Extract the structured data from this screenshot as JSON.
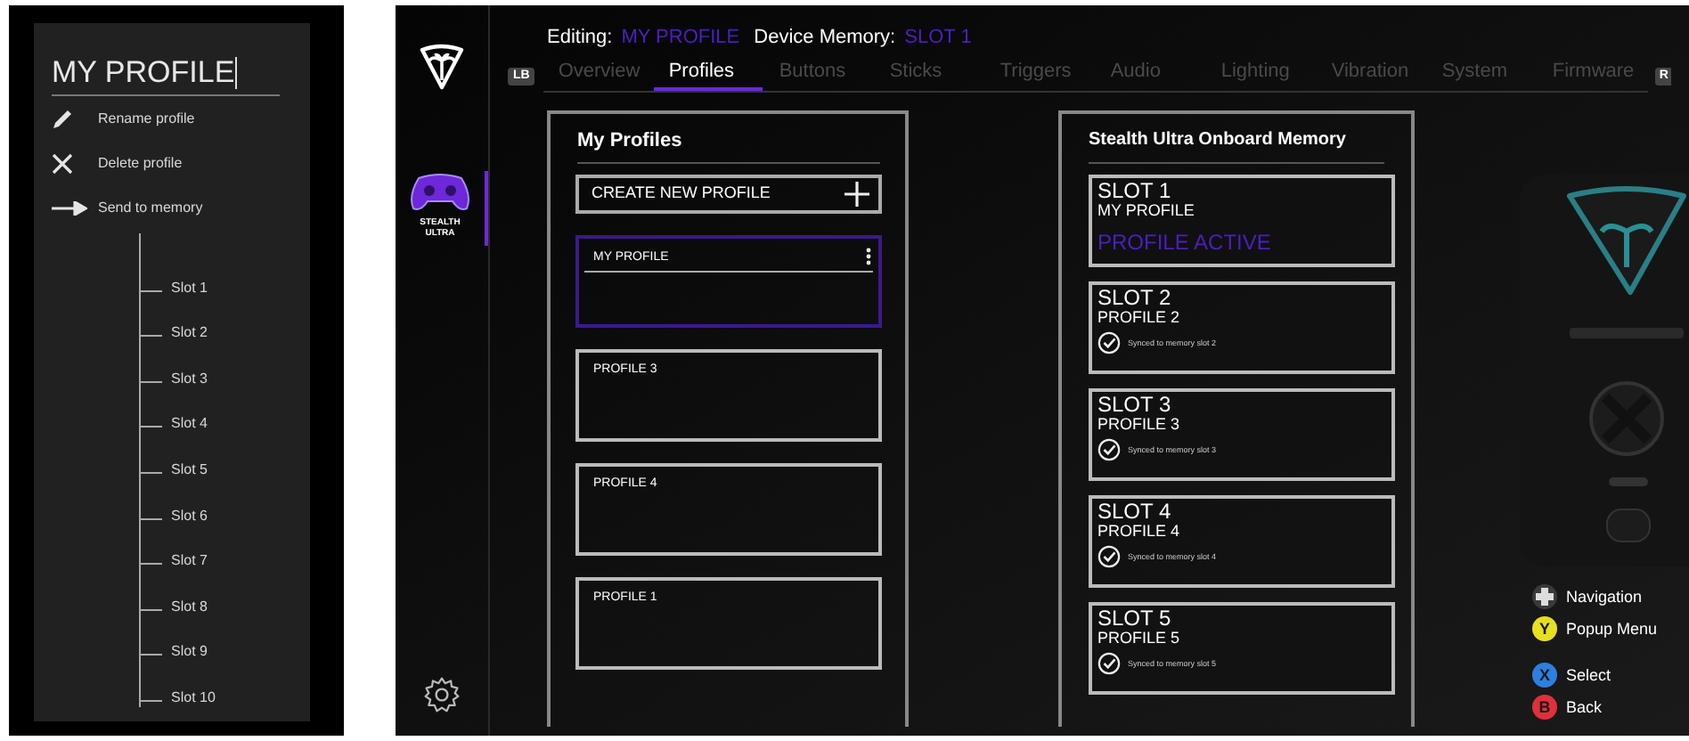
{
  "context_menu": {
    "title": "MY PROFILE",
    "actions": [
      {
        "label": "Rename profile",
        "kind": "rename"
      },
      {
        "label": "Delete profile",
        "kind": "delete"
      },
      {
        "label": "Send to memory",
        "kind": "send"
      }
    ],
    "slots": [
      "Slot 1",
      "Slot 2",
      "Slot 3",
      "Slot 4",
      "Slot 5",
      "Slot 6",
      "Slot 7",
      "Slot 8",
      "Slot 9",
      "Slot 10"
    ]
  },
  "sidebar": {
    "device_label": "STEALTH ULTRA"
  },
  "header": {
    "editing_label": "Editing:",
    "editing_value": "MY PROFILE",
    "memory_label": "Device Memory:",
    "memory_value": "SLOT 1"
  },
  "tabs": {
    "left_bumper": "LB",
    "right_bumper": "R",
    "items": [
      {
        "label": "Overview",
        "selected": false
      },
      {
        "label": "Profiles",
        "selected": true
      },
      {
        "label": "Buttons",
        "selected": false
      },
      {
        "label": "Sticks",
        "selected": false
      },
      {
        "label": "Triggers",
        "selected": false
      },
      {
        "label": "Audio",
        "selected": false
      },
      {
        "label": "Lighting",
        "selected": false
      },
      {
        "label": "Vibration",
        "selected": false
      },
      {
        "label": "System",
        "selected": false
      },
      {
        "label": "Firmware",
        "selected": false
      }
    ]
  },
  "profiles_panel": {
    "title": "My Profiles",
    "create_button": "CREATE NEW PROFILE",
    "profiles": [
      {
        "name": "MY PROFILE",
        "selected": true
      },
      {
        "name": "PROFILE 3",
        "selected": false
      },
      {
        "name": "PROFILE 4",
        "selected": false
      },
      {
        "name": "PROFILE 1",
        "selected": false
      }
    ]
  },
  "memory_panel": {
    "title": "Stealth Ultra Onboard Memory",
    "slots": [
      {
        "slot": "SLOT 1",
        "profile": "MY PROFILE",
        "status": "PROFILE ACTIVE",
        "kind": "active"
      },
      {
        "slot": "SLOT 2",
        "profile": "PROFILE 2",
        "status": "Synced to memory slot 2",
        "kind": "synced"
      },
      {
        "slot": "SLOT 3",
        "profile": "PROFILE 3",
        "status": "Synced to memory slot 3",
        "kind": "synced"
      },
      {
        "slot": "SLOT 4",
        "profile": "PROFILE 4",
        "status": "Synced to memory slot 4",
        "kind": "synced"
      },
      {
        "slot": "SLOT 5",
        "profile": "PROFILE 5",
        "status": "Synced to memory slot 5",
        "kind": "synced"
      }
    ]
  },
  "legend": [
    {
      "kind": "dpad",
      "label": "Navigation"
    },
    {
      "kind": "face",
      "button": "Y",
      "label": "Popup Menu",
      "color": "#e6e020"
    },
    {
      "kind": "face",
      "button": "X",
      "label": "Select",
      "color": "#2f7fe0"
    },
    {
      "kind": "face",
      "button": "B",
      "label": "Back",
      "color": "#e0303a"
    }
  ]
}
